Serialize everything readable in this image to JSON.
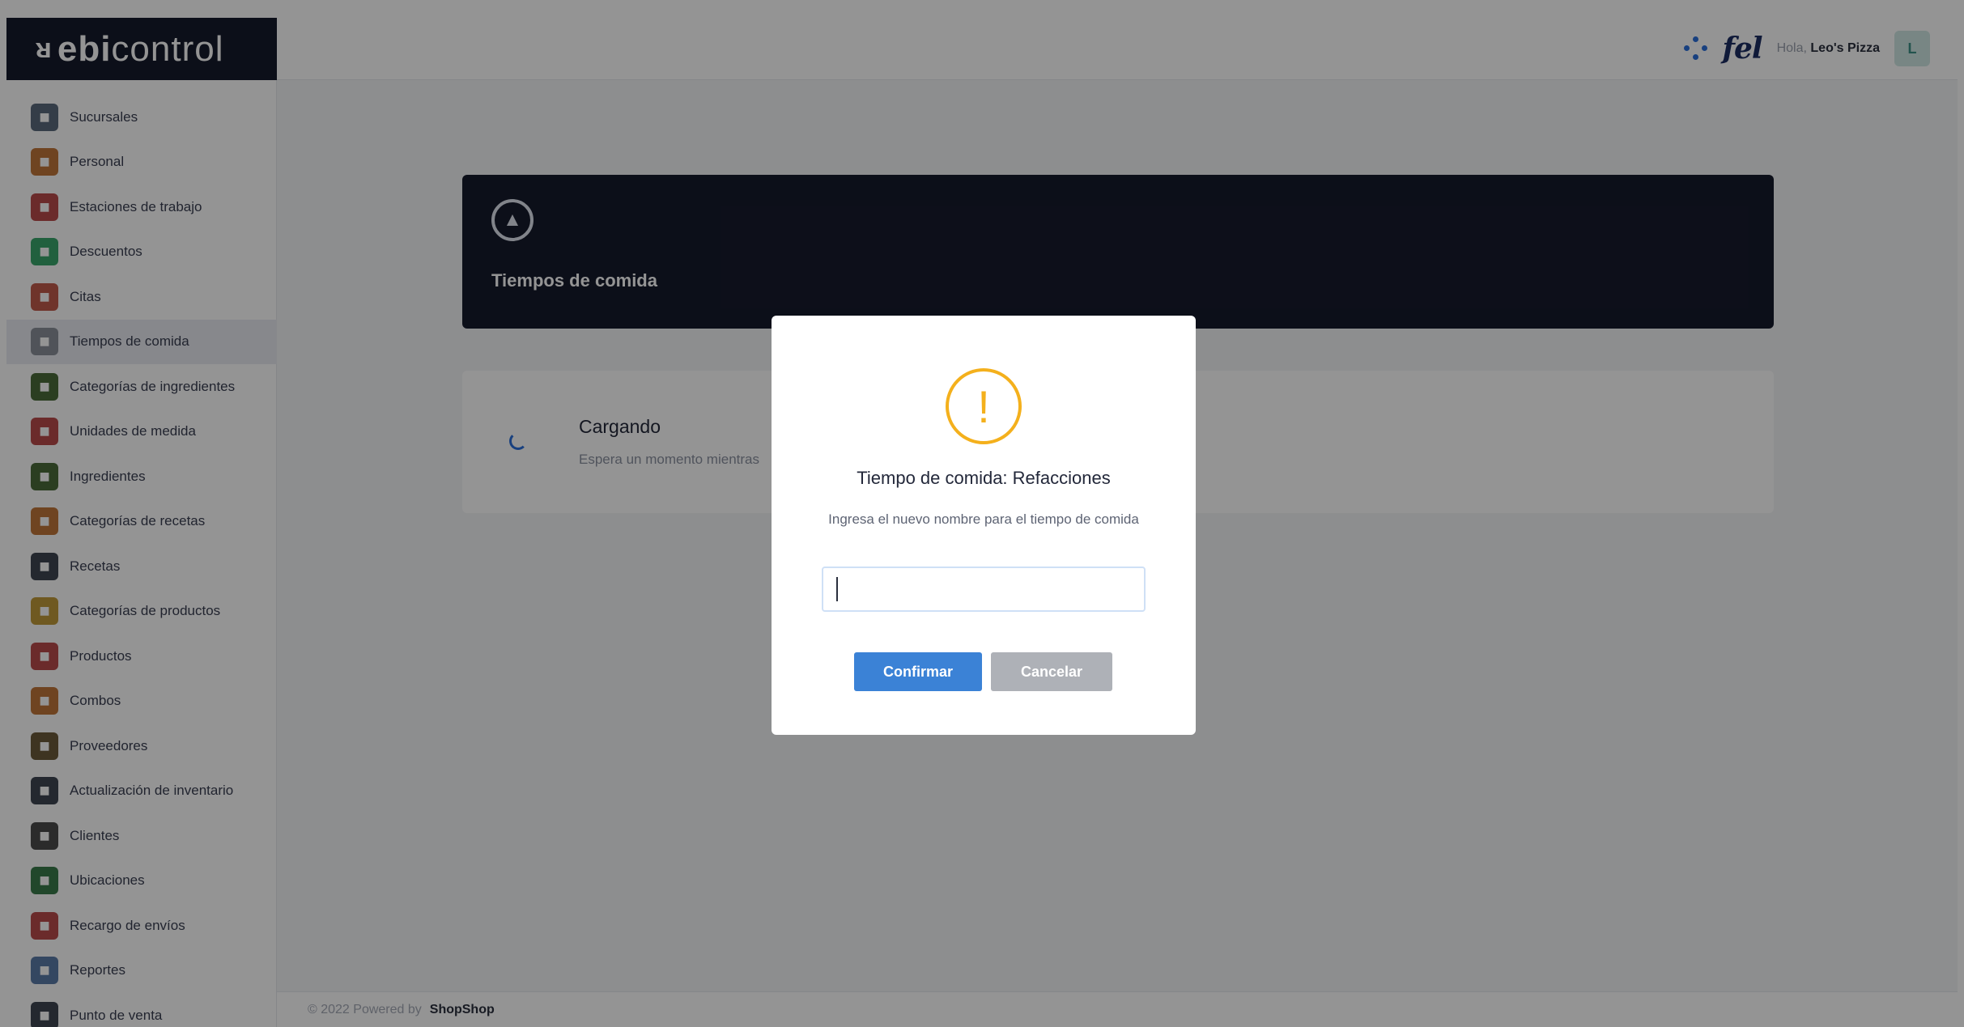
{
  "logo": {
    "mark": "ᴚ",
    "part1": "ebi",
    "part2": "control"
  },
  "topbar": {
    "greeting_prefix": "Hola,",
    "user_name": "Leo's Pizza",
    "avatar_initial": "L",
    "fel_logo_text": "fel"
  },
  "sidebar": {
    "items": [
      {
        "label": "Sucursales",
        "icon": "building-icon",
        "color": "#5b6a7d"
      },
      {
        "label": "Personal",
        "icon": "staff-icon",
        "color": "#c0763a"
      },
      {
        "label": "Estaciones de trabajo",
        "icon": "workstation-icon",
        "color": "#b84a4a"
      },
      {
        "label": "Descuentos",
        "icon": "discount-icon",
        "color": "#3aa56b"
      },
      {
        "label": "Citas",
        "icon": "calendar-icon",
        "color": "#c05a4a"
      },
      {
        "label": "Tiempos de comida",
        "icon": "food-dome-icon",
        "color": "#8a8f99"
      },
      {
        "label": "Categorías de ingredientes",
        "icon": "ingredient-category-icon",
        "color": "#4a6b3a"
      },
      {
        "label": "Unidades de medida",
        "icon": "measure-icon",
        "color": "#b84a4a"
      },
      {
        "label": "Ingredientes",
        "icon": "ingredients-icon",
        "color": "#4a6b3a"
      },
      {
        "label": "Categorías de recetas",
        "icon": "recipe-category-icon",
        "color": "#c0763a"
      },
      {
        "label": "Recetas",
        "icon": "recipe-book-icon",
        "color": "#3e4552"
      },
      {
        "label": "Categorías de productos",
        "icon": "product-category-icon",
        "color": "#c09a3a"
      },
      {
        "label": "Productos",
        "icon": "products-icon",
        "color": "#b84a4a"
      },
      {
        "label": "Combos",
        "icon": "combo-icon",
        "color": "#c0763a"
      },
      {
        "label": "Proveedores",
        "icon": "suppliers-icon",
        "color": "#6b5a3a"
      },
      {
        "label": "Actualización de inventario",
        "icon": "inventory-icon",
        "color": "#3e4552"
      },
      {
        "label": "Clientes",
        "icon": "customer-icon",
        "color": "#4a4a4a"
      },
      {
        "label": "Ubicaciones",
        "icon": "location-icon",
        "color": "#3a7a4a"
      },
      {
        "label": "Recargo de envíos",
        "icon": "delivery-icon",
        "color": "#b84a4a"
      },
      {
        "label": "Reportes",
        "icon": "report-icon",
        "color": "#5b7aa8"
      },
      {
        "label": "Punto de venta",
        "icon": "pos-icon",
        "color": "#3e4552"
      }
    ],
    "active_index": 5
  },
  "header_card": {
    "title": "Tiempos de comida",
    "icon": "food-dome-icon"
  },
  "loading_card": {
    "title": "Cargando",
    "subtitle": "Espera un momento mientras"
  },
  "footer": {
    "text": "© 2022 Powered by",
    "brand": "ShopShop"
  },
  "modal": {
    "icon": "warning-icon",
    "title": "Tiempo de comida: Refacciones",
    "text": "Ingresa el nuevo nombre para el tiempo de comida",
    "input_value": "",
    "confirm_label": "Confirmar",
    "cancel_label": "Cancelar",
    "confirm_color": "#3b82d6",
    "cancel_color": "#aeb1b7",
    "icon_color": "#f4b01c"
  }
}
